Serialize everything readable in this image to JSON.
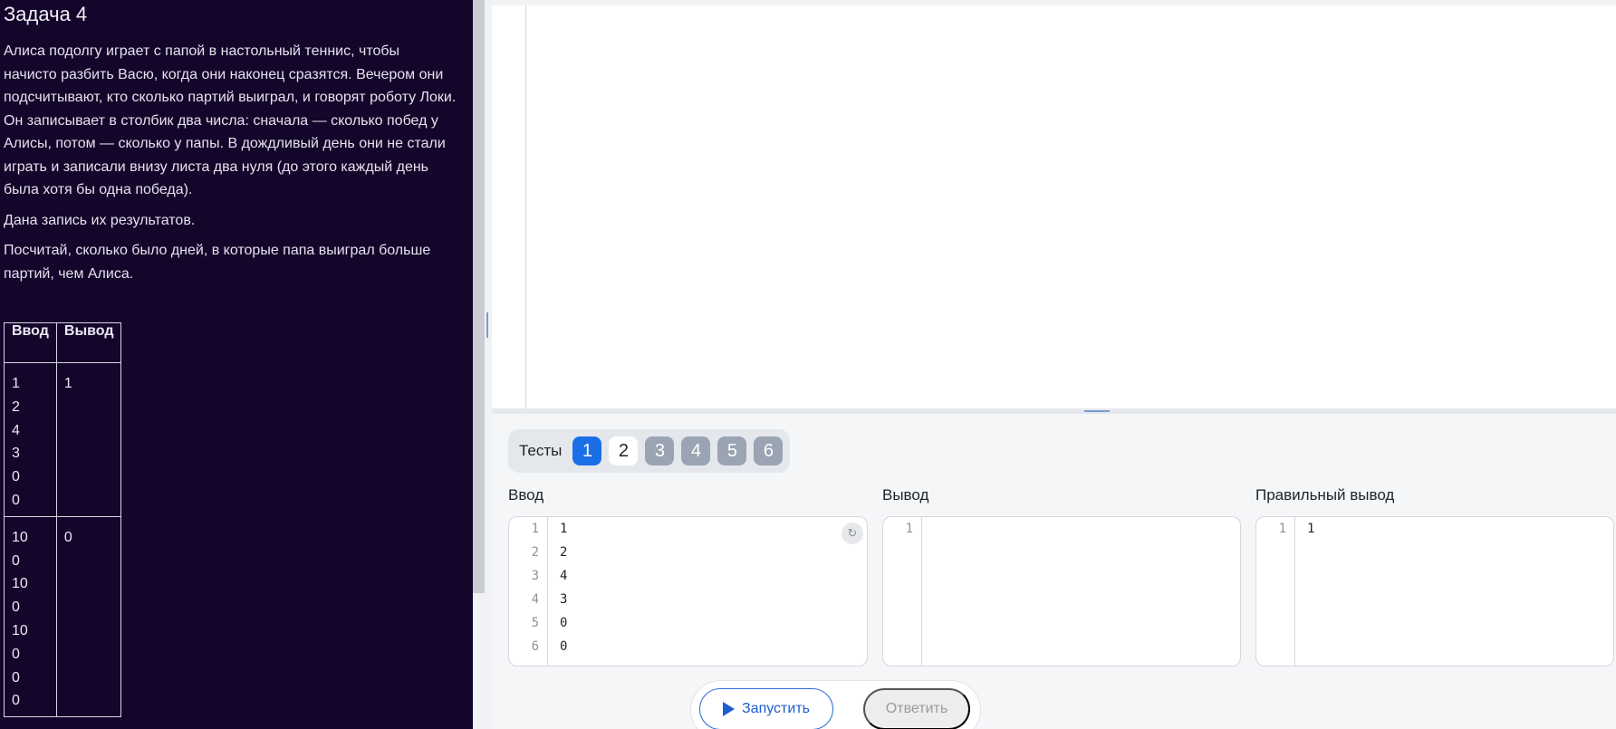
{
  "task": {
    "title": "Задача 4",
    "paragraphs": [
      "Алиса подолгу играет с папой в настольный теннис, чтобы начисто разбить Васю, когда они наконец сразятся. Вечером они подсчитывают, кто сколько партий выиграл, и говорят роботу Локи. Он записывает в столбик два числа: сначала — сколько побед у Алисы, потом — сколько у папы. В дождливый день они не стали играть и записали внизу листа два нуля (до этого каждый день была хотя бы одна победа).",
      "Дана запись их результатов.",
      "Посчитай, сколько было дней, в которые папа выиграл больше партий, чем Алиса."
    ],
    "examples": {
      "header_in": "Ввод",
      "header_out": "Вывод",
      "rows": [
        {
          "input": [
            "1",
            "2",
            "4",
            "3",
            "0",
            "0"
          ],
          "output": "1"
        },
        {
          "input": [
            "10",
            "0",
            "10",
            "0",
            "10",
            "0",
            "0",
            "0"
          ],
          "output": "0"
        }
      ]
    }
  },
  "tests": {
    "label": "Тесты",
    "items": [
      "1",
      "2",
      "3",
      "4",
      "5",
      "6"
    ],
    "active": "1"
  },
  "io": {
    "input_label": "Ввод",
    "output_label": "Вывод",
    "expected_label": "Правильный вывод",
    "input_lines": [
      {
        "n": "1",
        "v": "1"
      },
      {
        "n": "2",
        "v": "2"
      },
      {
        "n": "3",
        "v": "4"
      },
      {
        "n": "4",
        "v": "3"
      },
      {
        "n": "5",
        "v": "0"
      },
      {
        "n": "6",
        "v": "0"
      }
    ],
    "output_lines": [
      {
        "n": "1",
        "v": ""
      }
    ],
    "expected_lines": [
      {
        "n": "1",
        "v": "1"
      }
    ]
  },
  "actions": {
    "run_label": "Запустить",
    "answer_label": "Ответить"
  }
}
